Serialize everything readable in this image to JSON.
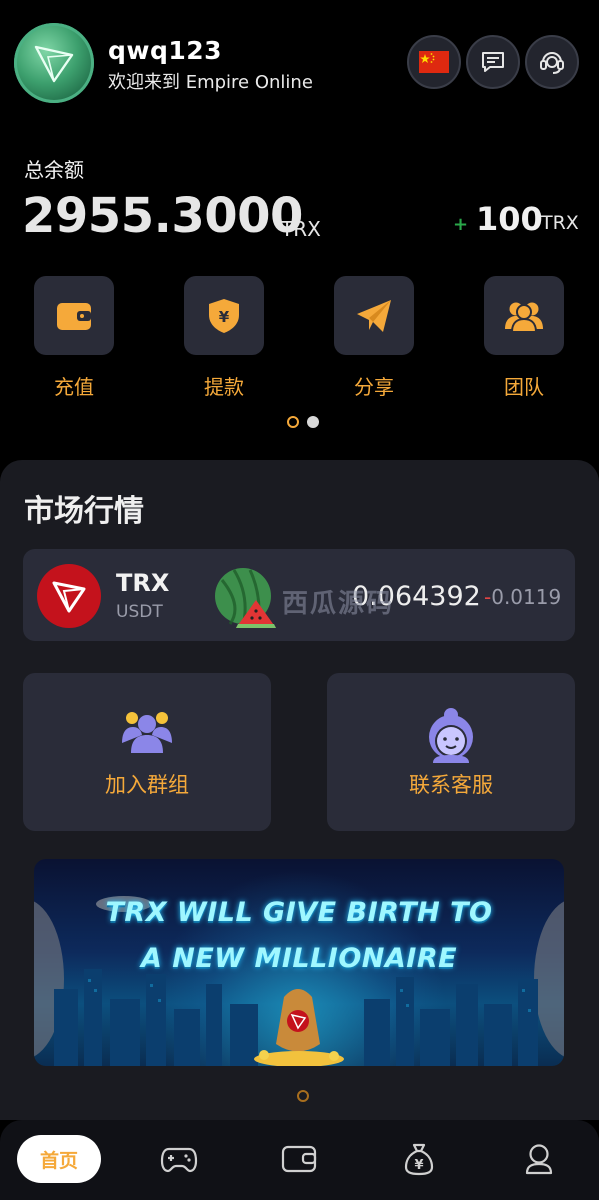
{
  "header": {
    "username": "qwq123",
    "welcome": "欢迎来到 Empire Online",
    "buttons": [
      {
        "icon": "china-flag-icon"
      },
      {
        "icon": "message-icon"
      },
      {
        "icon": "customer-service-icon"
      }
    ]
  },
  "balance": {
    "label": "总余额",
    "value": "2955.3000",
    "unit": "TRX",
    "bonus_sign": "+",
    "bonus_value": "100",
    "bonus_unit": "TRX"
  },
  "actions": [
    {
      "label": "充值",
      "icon": "wallet-icon"
    },
    {
      "label": "提款",
      "icon": "shield-yen-icon"
    },
    {
      "label": "分享",
      "icon": "paper-plane-icon"
    },
    {
      "label": "团队",
      "icon": "team-icon"
    }
  ],
  "market": {
    "title": "市场行情",
    "ticker": {
      "symbol": "TRX",
      "quote": "USDT",
      "price": "0.064392",
      "change_sign": "-",
      "change": "0.0119"
    },
    "watermark": "西瓜源码"
  },
  "cards": [
    {
      "label": "加入群组",
      "icon": "group-icon"
    },
    {
      "label": "联系客服",
      "icon": "support-agent-icon"
    }
  ],
  "banner": {
    "line1": "TRX WILL GIVE BIRTH  TO",
    "line2": "A NEW MILLIONAIRE"
  },
  "nav": {
    "home": "首页",
    "items": [
      {
        "icon": "gamepad-icon"
      },
      {
        "icon": "wallet-icon"
      },
      {
        "icon": "money-bag-icon"
      },
      {
        "icon": "user-icon"
      }
    ]
  },
  "colors": {
    "accent": "#f5a93a",
    "background": "#000000",
    "panel": "#1a1b21",
    "card": "#2a2c39",
    "negative": "#e04545",
    "positive": "#2aa84a",
    "trx_red": "#c4121c"
  }
}
